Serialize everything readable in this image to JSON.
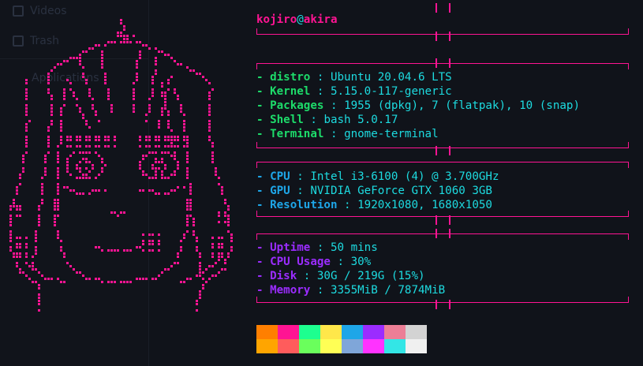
{
  "prompt": {
    "user": "kojiro",
    "at": "@",
    "host": "akira"
  },
  "ghost_sidebar": [
    "Videos",
    "Trash",
    "Applications"
  ],
  "groups": [
    {
      "color": "#1ddb6a",
      "items": [
        {
          "key": "distro",
          "value": "Ubuntu 20.04.6 LTS"
        },
        {
          "key": "Kernel",
          "value": "5.15.0-117-generic"
        },
        {
          "key": "Packages",
          "value": "1955 (dpkg), 7 (flatpak), 10 (snap)"
        },
        {
          "key": "Shell",
          "value": "bash 5.0.17"
        },
        {
          "key": "Terminal",
          "value": "gnome-terminal"
        }
      ]
    },
    {
      "color": "#1ea6e8",
      "items": [
        {
          "key": "CPU",
          "value": "Intel i3-6100 (4) @ 3.700GHz"
        },
        {
          "key": "GPU",
          "value": "NVIDIA GeForce GTX 1060 3GB"
        },
        {
          "key": "Resolution",
          "value": "1920x1080, 1680x1050"
        }
      ]
    },
    {
      "color": "#9b2cff",
      "items": [
        {
          "key": "Uptime",
          "value": "50 mins"
        },
        {
          "key": "CPU Usage",
          "value": "30%"
        },
        {
          "key": "Disk",
          "value": "30G / 219G (15%)"
        },
        {
          "key": "Memory",
          "value": "3355MiB / 7874MiB"
        }
      ]
    }
  ],
  "colors": {
    "accent": "#ff1493",
    "value": "#1ddbe0",
    "background": "#10131a",
    "palette_top": [
      "#ff7f00",
      "#ff1493",
      "#1dff8f",
      "#ffe74a",
      "#1ea6e8",
      "#9b2cff",
      "#ec7e96",
      "#d3d3d3"
    ],
    "palette_bottom": [
      "#ffa500",
      "#ff5c5c",
      "#6aff5c",
      "#ffff55",
      "#7fa6d9",
      "#ff33ff",
      "#33e6e6",
      "#f0f0f0"
    ]
  },
  "ascii_art_name": "anime-girl-dotted-portrait"
}
